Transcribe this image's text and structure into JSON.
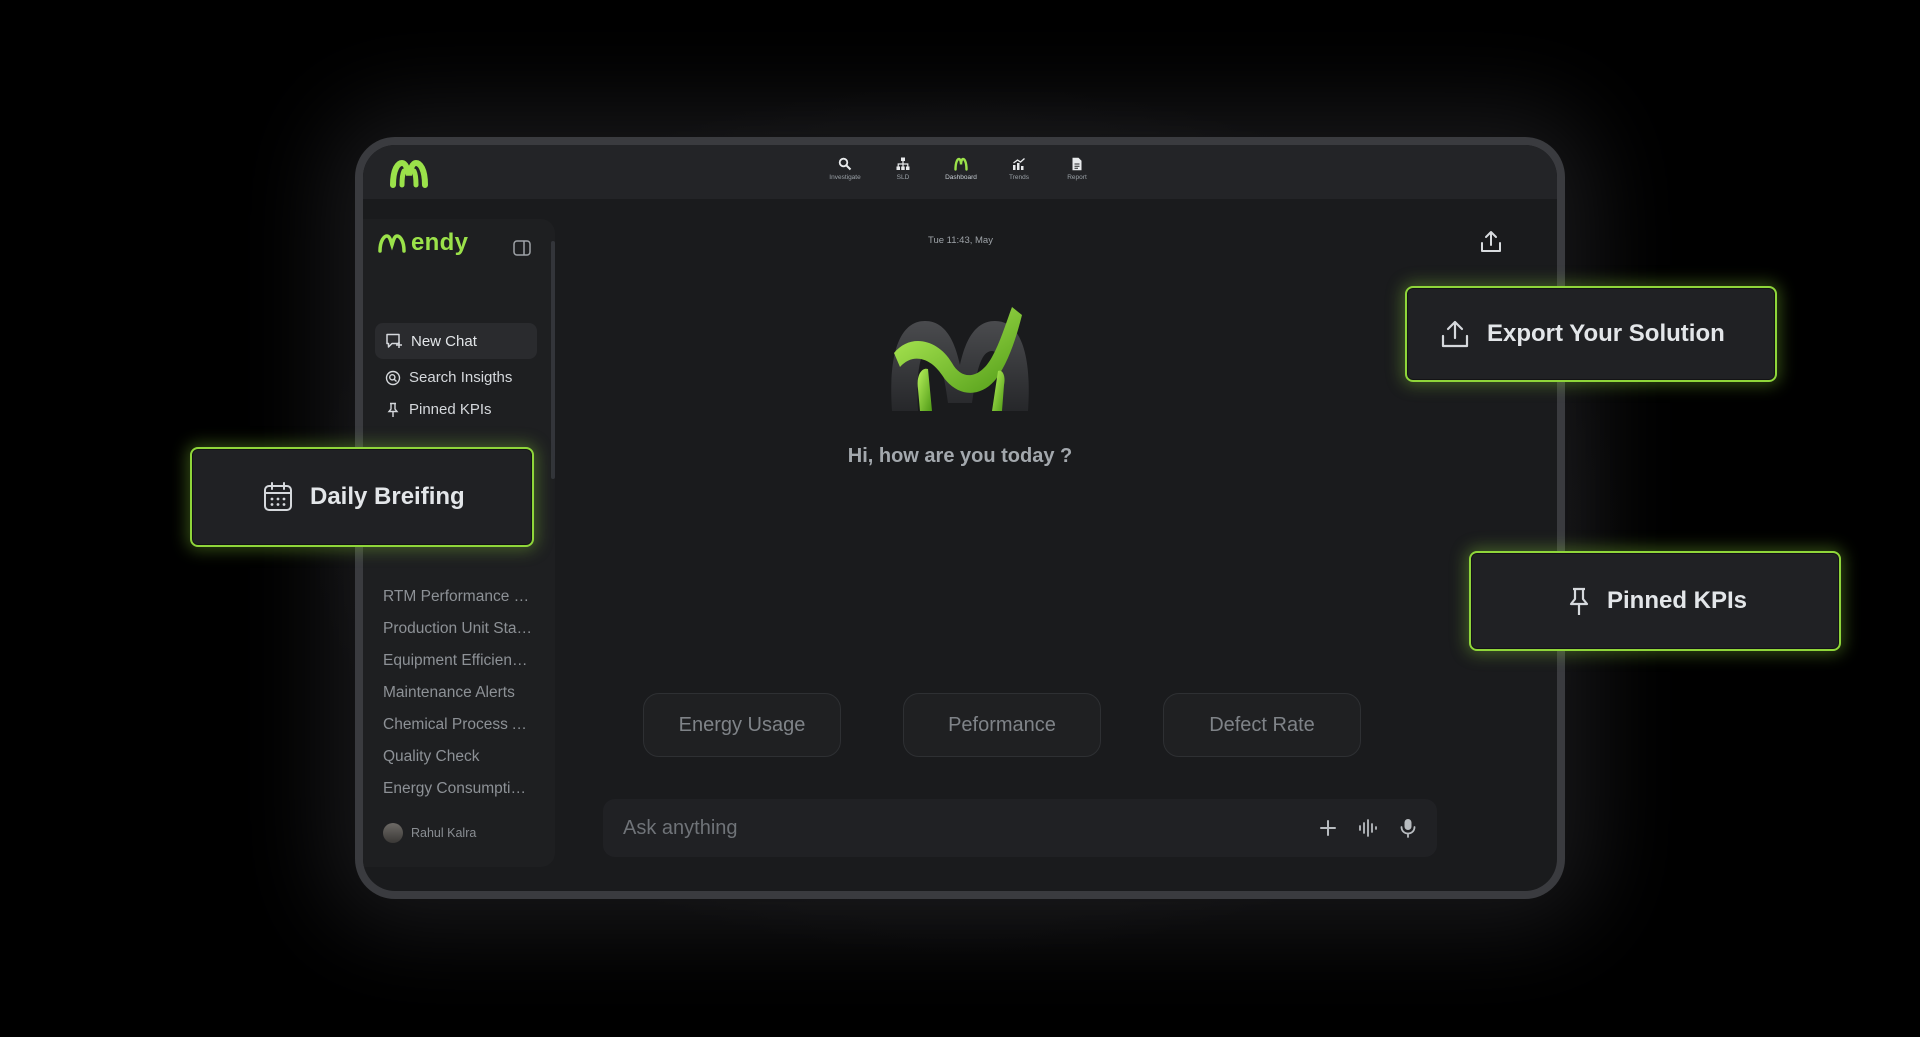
{
  "topbar": {
    "nav": [
      {
        "label": "Investigate",
        "icon": "search-icon"
      },
      {
        "label": "SLD",
        "icon": "hierarchy-icon"
      },
      {
        "label": "Dashboard",
        "icon": "brand-m-icon",
        "active": true
      },
      {
        "label": "Trends",
        "icon": "trend-chart-icon"
      },
      {
        "label": "Report",
        "icon": "document-icon"
      }
    ]
  },
  "sidebar": {
    "brand": "endy",
    "new_chat": "New Chat",
    "search": "Search Insigths",
    "pinned": "Pinned KPIs",
    "history": [
      "RTM Performance Summary",
      "Production Unit Status",
      "Equipment Efficiency Report",
      "Maintenance Alerts",
      "Chemical Process Analysis",
      "Quality Check",
      "Energy Consumption Trends"
    ],
    "user": "Rahul Kalra"
  },
  "main": {
    "timestamp": "Tue 11:43, May",
    "greeting": "Hi, how are you today ?",
    "suggestions": [
      "Energy Usage",
      "Peformance",
      "Defect Rate"
    ],
    "composer_placeholder": "Ask anything"
  },
  "callouts": {
    "daily_briefing": "Daily Breifing",
    "export": "Export Your Solution",
    "pinned": "Pinned KPIs"
  },
  "colors": {
    "accent": "#9be24a",
    "background": "#000000",
    "panel": "#1a1b1d"
  }
}
